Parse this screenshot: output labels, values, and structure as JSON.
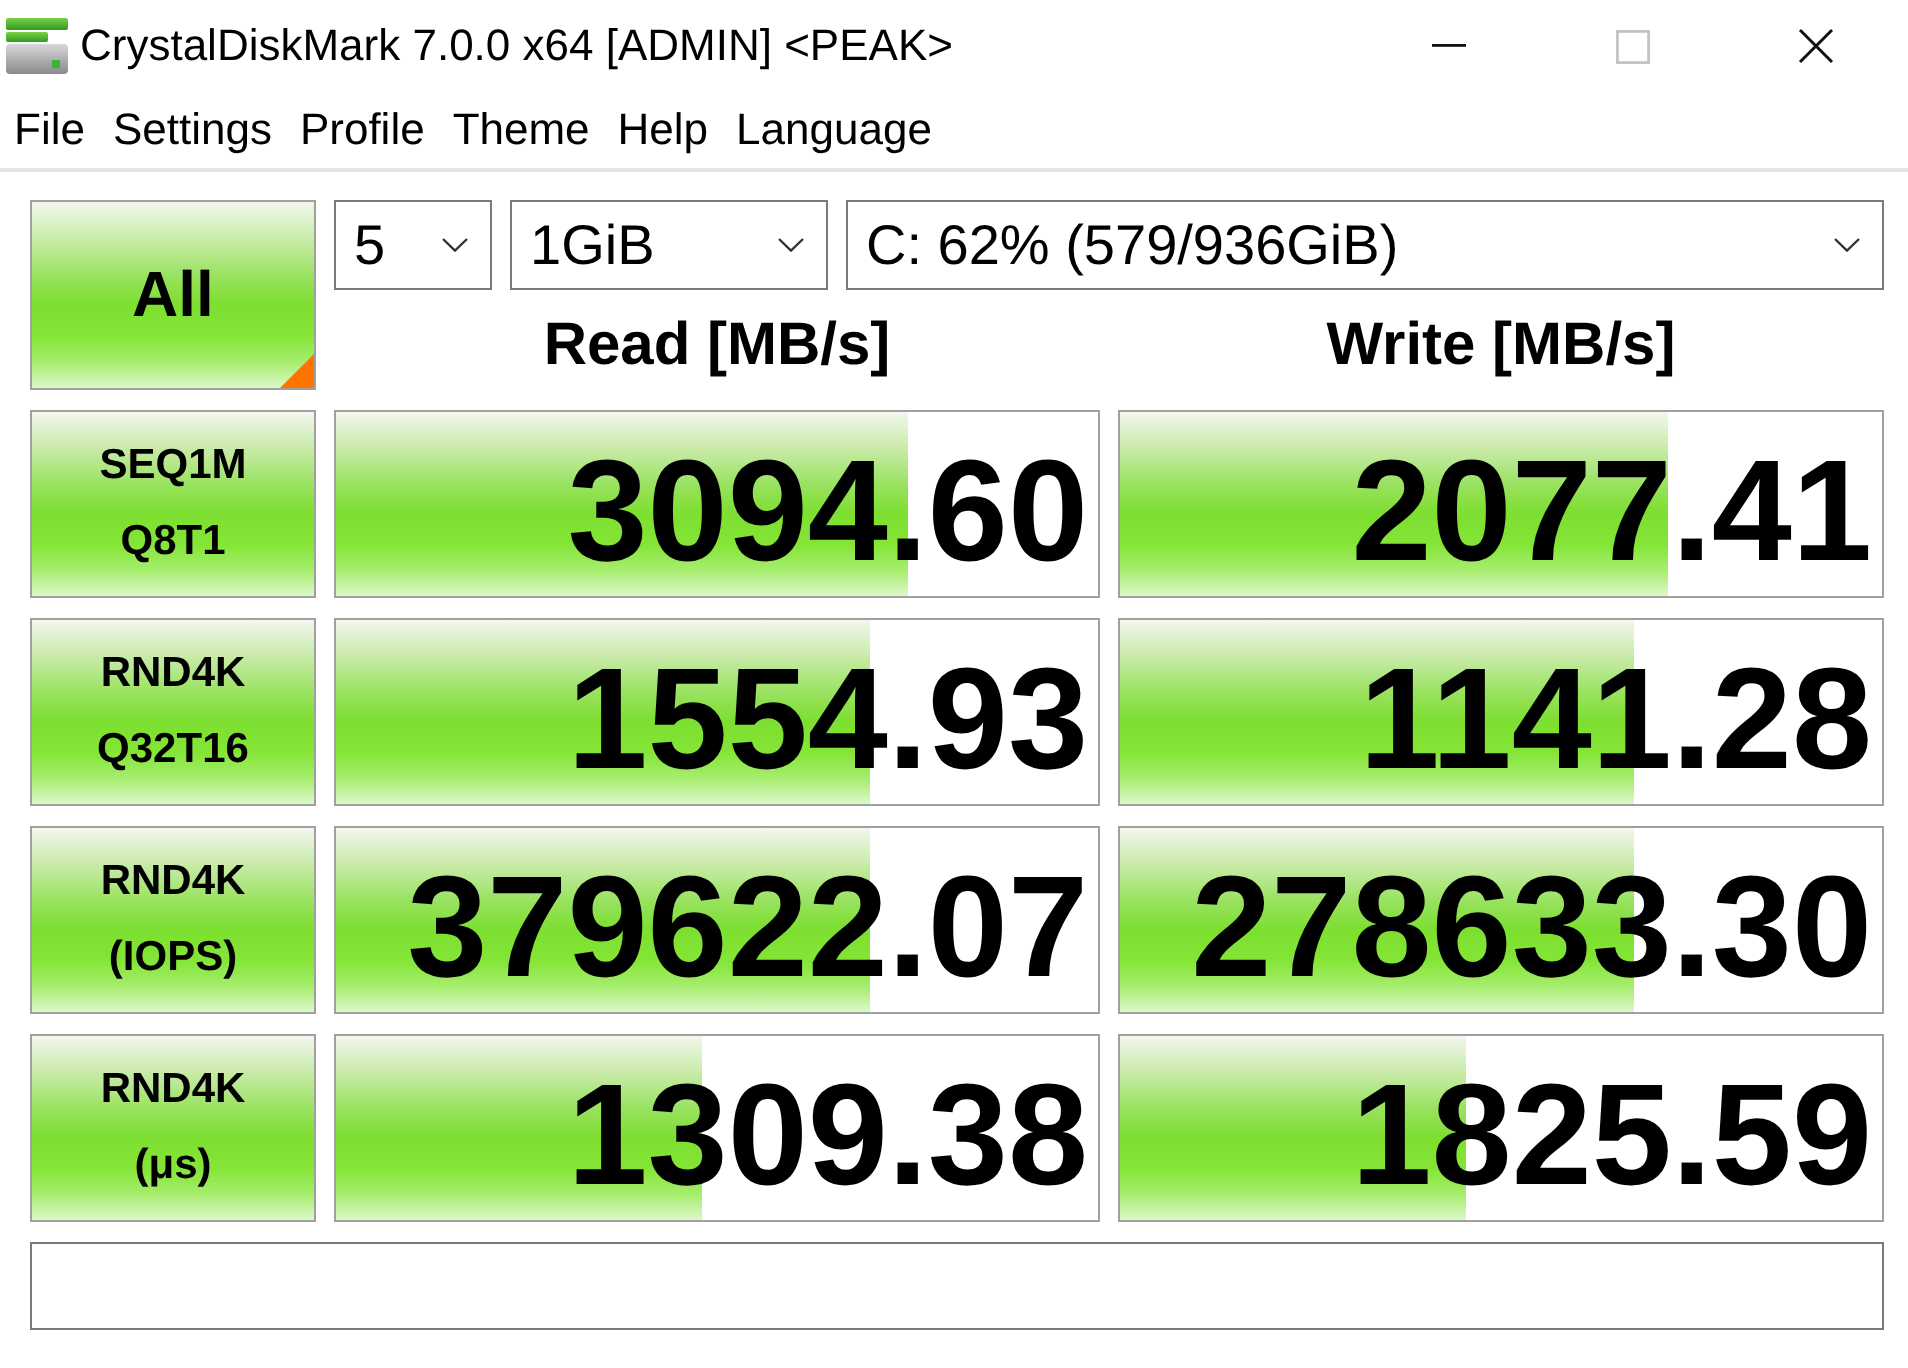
{
  "window": {
    "title": "CrystalDiskMark 7.0.0 x64 [ADMIN] <PEAK>",
    "maximize_disabled": true
  },
  "menu": [
    "File",
    "Settings",
    "Profile",
    "Theme",
    "Help",
    "Language"
  ],
  "toolbar": {
    "all_button": "All",
    "count": "5",
    "size": "1GiB",
    "drive": "C: 62% (579/936GiB)"
  },
  "columns": [
    "Read [MB/s]",
    "Write [MB/s]"
  ],
  "tests": [
    {
      "label": [
        "SEQ1M",
        "Q8T1"
      ],
      "read": {
        "value": "3094.60",
        "level": 0.75
      },
      "write": {
        "value": "2077.41",
        "level": 0.72
      }
    },
    {
      "label": [
        "RND4K",
        "Q32T16"
      ],
      "read": {
        "value": "1554.93",
        "level": 0.7
      },
      "write": {
        "value": "1141.28",
        "level": 0.675
      }
    },
    {
      "label": [
        "RND4K",
        "(IOPS)"
      ],
      "read": {
        "value": "379622.07",
        "level": 0.7
      },
      "write": {
        "value": "278633.30",
        "level": 0.675
      }
    },
    {
      "label": [
        "RND4K",
        "(μs)"
      ],
      "read": {
        "value": "1309.38",
        "level": 0.48
      },
      "write": {
        "value": "1825.59",
        "level": 0.455
      }
    }
  ]
}
